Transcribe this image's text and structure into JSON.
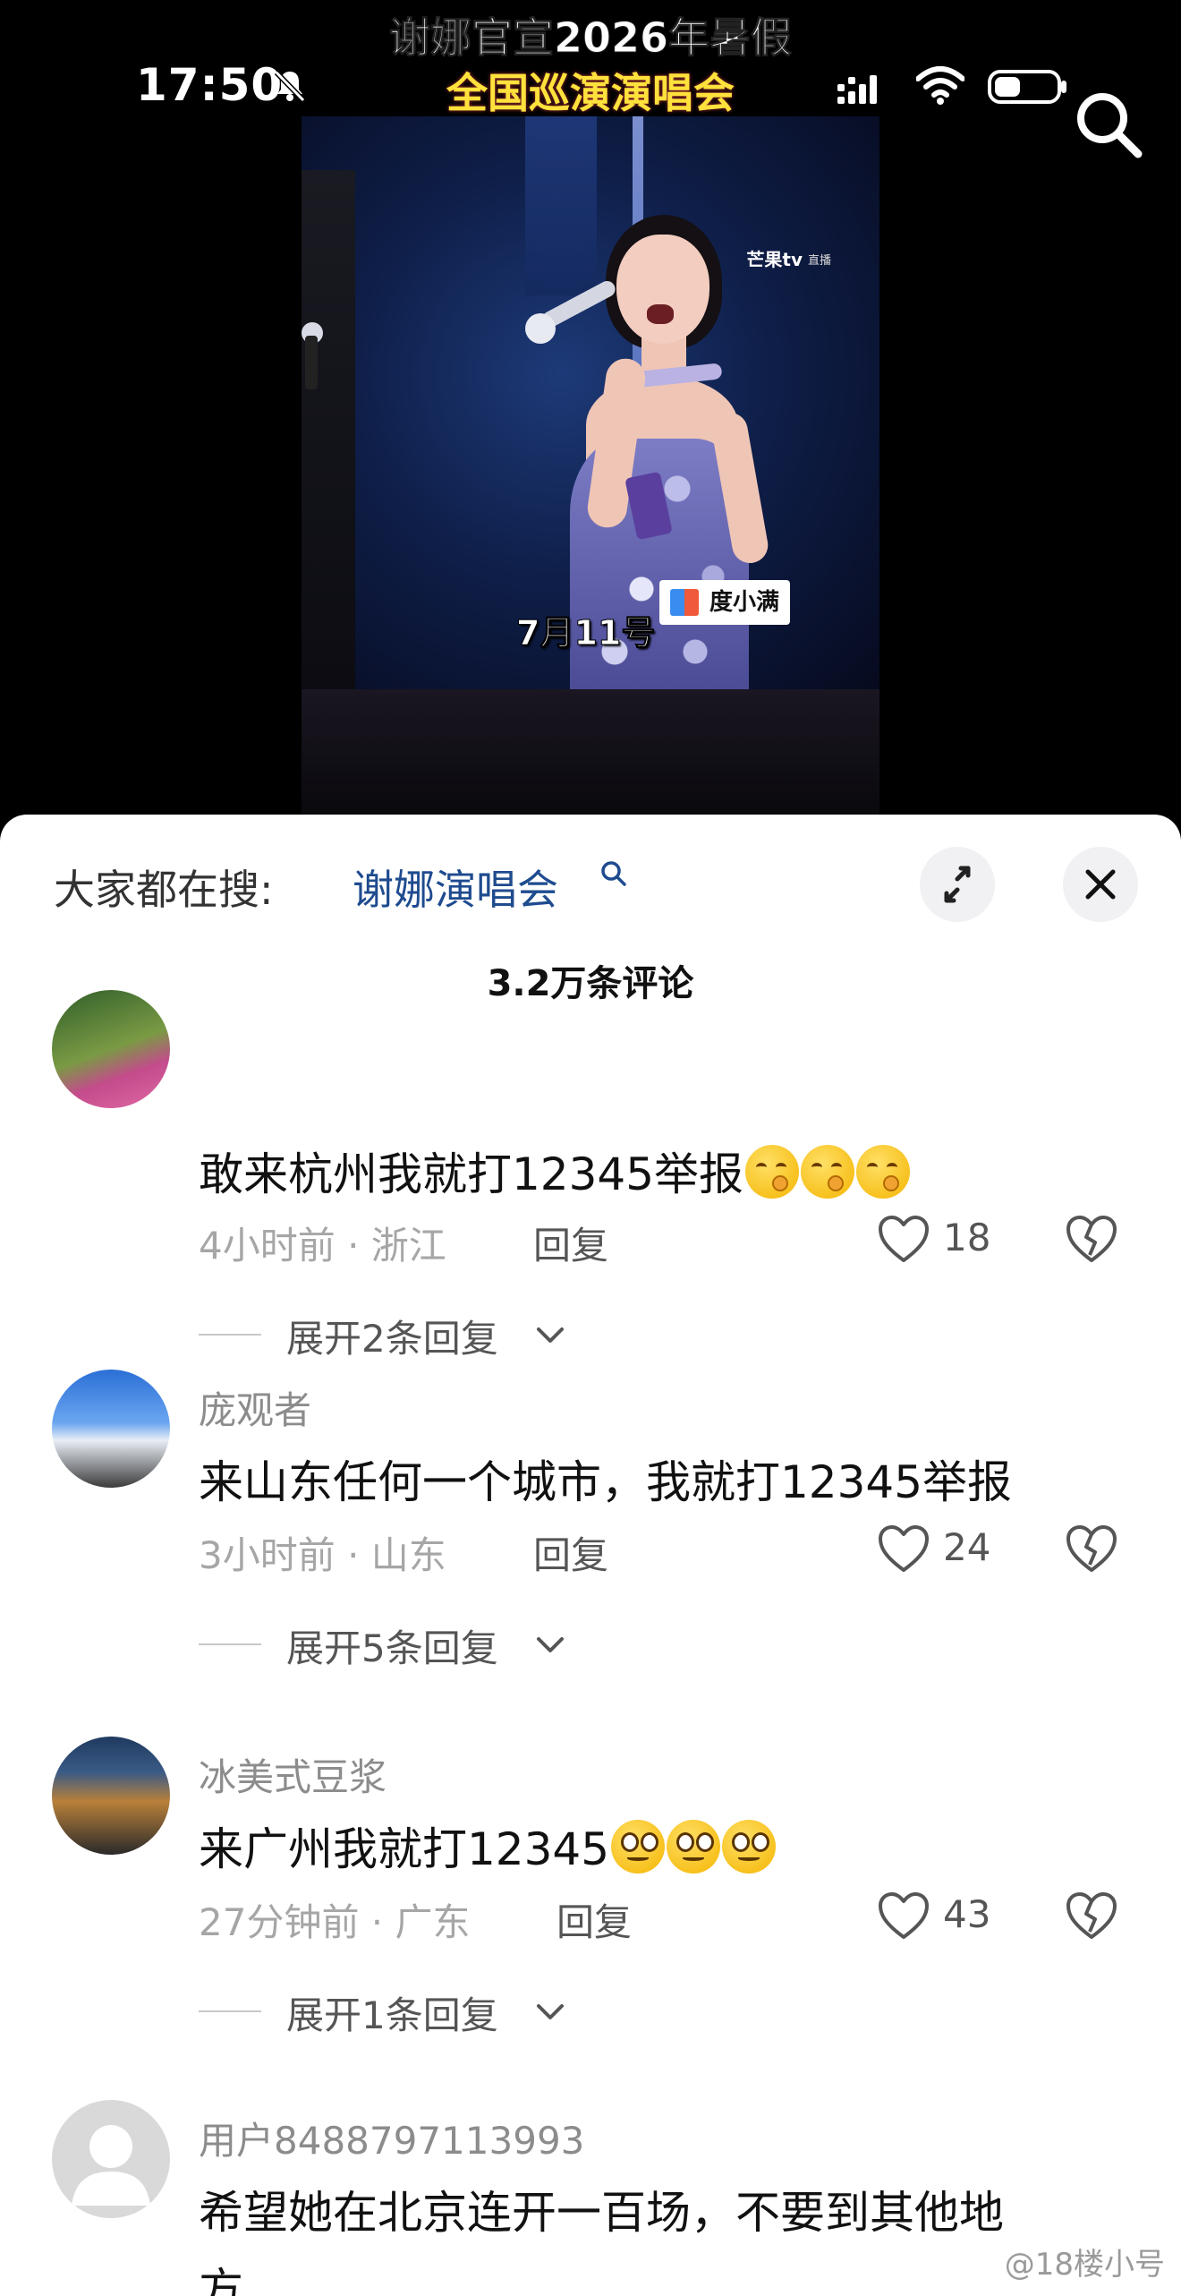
{
  "status_bar": {
    "time": "17:50"
  },
  "video": {
    "title_line1": "谢娜官宣2026年暑假",
    "title_line2": "全国巡演演唱会",
    "channel_watermark": "芒果tv",
    "live_badge": "直播",
    "sponsor": "度小满",
    "caption": "7月11号"
  },
  "panel": {
    "search_label": "大家都在搜:",
    "search_term": "谢娜演唱会",
    "comment_count": "3.2万条评论"
  },
  "comments": [
    {
      "username": "",
      "text": "敢来杭州我就打12345举报",
      "emoji": "smirk",
      "emoji_count": 3,
      "time": "4小时前",
      "location": "浙江",
      "reply_label": "回复",
      "likes": "18",
      "expand": "展开2条回复"
    },
    {
      "username": "庞观者",
      "text": "来山东任何一个城市，我就打12345举报",
      "emoji": "",
      "emoji_count": 0,
      "time": "3小时前",
      "location": "山东",
      "reply_label": "回复",
      "likes": "24",
      "expand": "展开5条回复"
    },
    {
      "username": "冰美式豆浆",
      "text": "来广州我就打12345",
      "emoji": "blank",
      "emoji_count": 3,
      "time": "27分钟前",
      "location": "广东",
      "reply_label": "回复",
      "likes": "43",
      "expand": "展开1条回复"
    },
    {
      "username": "用户8488797113993",
      "text": "希望她在北京连开一百场，不要到其他地",
      "text_cont": "方"
    }
  ],
  "watermark": "@18楼小号",
  "colors": {
    "accent_link": "#1f4b8f",
    "title_yellow": "#ffe23c"
  }
}
